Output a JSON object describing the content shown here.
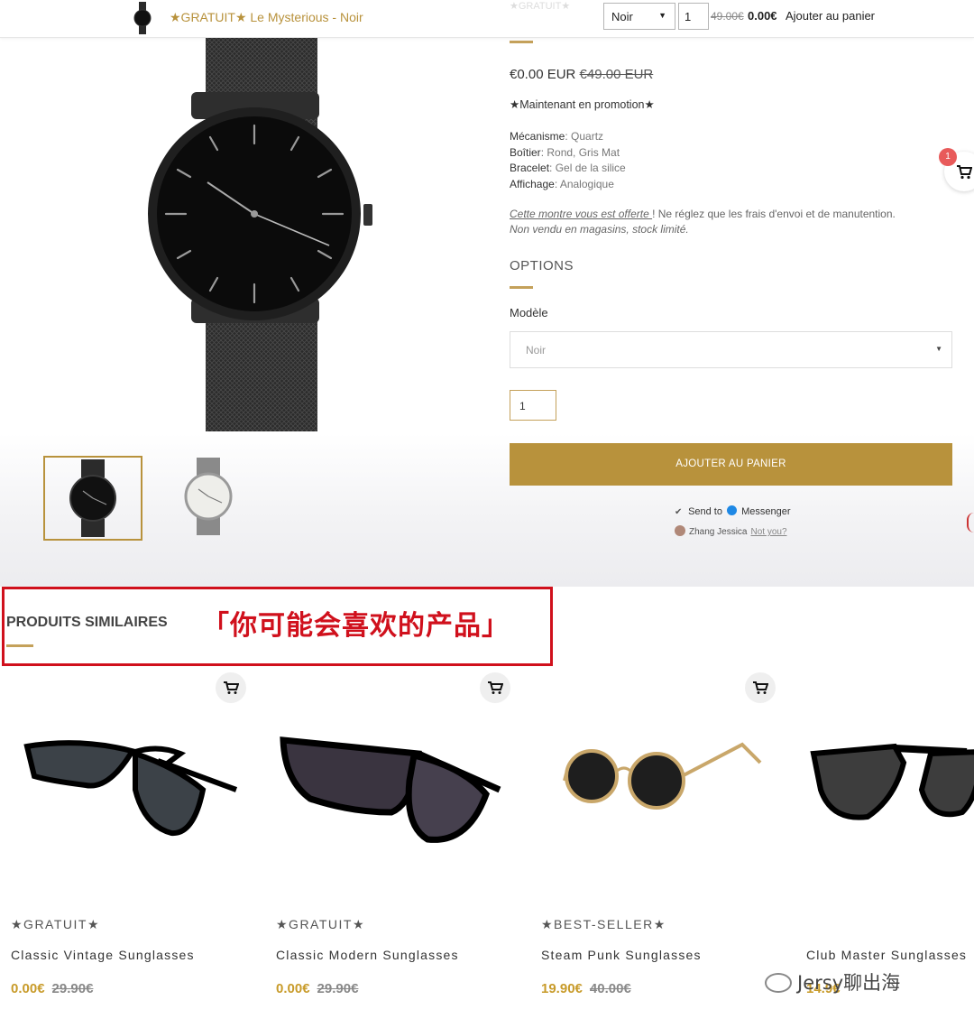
{
  "sticky_bar": {
    "product_title": "★GRATUIT★ Le Mysterious - Noir",
    "ghost_text": "★GRATUIT★",
    "variant": "Noir",
    "quantity": "1",
    "old_price": "49.00€",
    "new_price": "0.00€",
    "add_label": "Ajouter au panier"
  },
  "product": {
    "price_current": "€0.00 EUR",
    "price_old": "€49.00 EUR",
    "promo": "★Maintenant en promotion★",
    "specs": [
      {
        "label": "Mécanisme",
        "value": ": Quartz"
      },
      {
        "label": "Boîtier",
        "value": ": Rond, Gris Mat"
      },
      {
        "label": "Bracelet",
        "value": ": Gel de la silice"
      },
      {
        "label": "Affichage",
        "value": ": Analogique"
      }
    ],
    "offer_link": "Cette montre vous est offerte ",
    "offer_rest": "! Ne réglez que les frais d'envoi et de manutention.",
    "offer_note": "Non vendu en magasins, stock limité.",
    "options_heading": "OPTIONS",
    "model_label": "Modèle",
    "model_value": "Noir",
    "quantity": "1",
    "add_to_cart": "AJOUTER AU PANIER",
    "messenger": {
      "send_to": "Send to",
      "app": "Messenger",
      "user": "Zhang Jessica",
      "not_you": "Not you?"
    },
    "cart_count": "1"
  },
  "similar": {
    "heading": "PRODUITS SIMILAIRES",
    "annotation": "「你可能会喜欢的产品」",
    "items": [
      {
        "tag": "★GRATUIT★",
        "name": "Classic Vintage Sunglasses",
        "price": "0.00€",
        "old_price": "29.90€"
      },
      {
        "tag": "★GRATUIT★",
        "name": "Classic Modern Sunglasses",
        "price": "0.00€",
        "old_price": "29.90€"
      },
      {
        "tag": "★BEST-SELLER★",
        "name": "Steam Punk Sunglasses",
        "price": "19.90€",
        "old_price": "40.00€"
      },
      {
        "tag": "",
        "name": "Club Master Sunglasses",
        "price": "14.9€",
        "old_price": ""
      }
    ]
  },
  "watermark": "Jersy聊出海",
  "colors": {
    "gold": "#b8923c",
    "red_annotation": "#d0101c",
    "badge": "#e85a5a"
  },
  "icons": [
    "cart-icon",
    "chevron-down-icon",
    "checkbox-icon",
    "messenger-icon",
    "wechat-icon"
  ]
}
